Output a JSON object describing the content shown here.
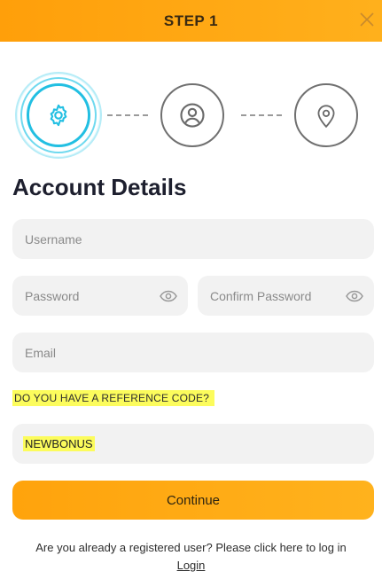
{
  "header": {
    "title": "STEP 1"
  },
  "steps": [
    {
      "icon": "gear-icon",
      "state": "active"
    },
    {
      "icon": "user-icon",
      "state": "inactive"
    },
    {
      "icon": "location-pin-icon",
      "state": "inactive"
    }
  ],
  "form": {
    "title": "Account Details",
    "username_placeholder": "Username",
    "password_placeholder": "Password",
    "confirm_password_placeholder": "Confirm Password",
    "email_placeholder": "Email",
    "reference_question": "DO YOU HAVE A REFERENCE CODE?",
    "reference_code_value": "NEWBONUS",
    "continue_label": "Continue"
  },
  "footer": {
    "text": "Are you already a registered user? Please click here to log in",
    "login_link": "Login"
  },
  "colors": {
    "header": "#ffa30c",
    "active_step": "#22bfe2",
    "highlight": "#fcfc5c",
    "field_bg": "#f2f2f2"
  }
}
